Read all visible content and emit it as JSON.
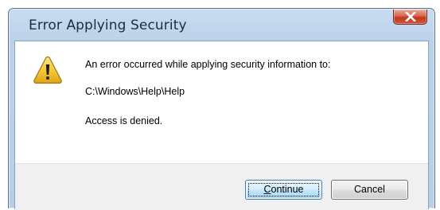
{
  "dialog": {
    "title": "Error Applying Security",
    "icon": "warning-icon",
    "message_line1": "An error occurred while applying security information to:",
    "path": "C:\\Windows\\Help\\Help",
    "message_line3": "Access is denied.",
    "buttons": {
      "continue_accel": "C",
      "continue_rest": "ontinue",
      "cancel": "Cancel"
    },
    "colors": {
      "close_button": "#c3361c",
      "warning_fill": "#f2c230",
      "frame": "#bcd2ea"
    }
  }
}
